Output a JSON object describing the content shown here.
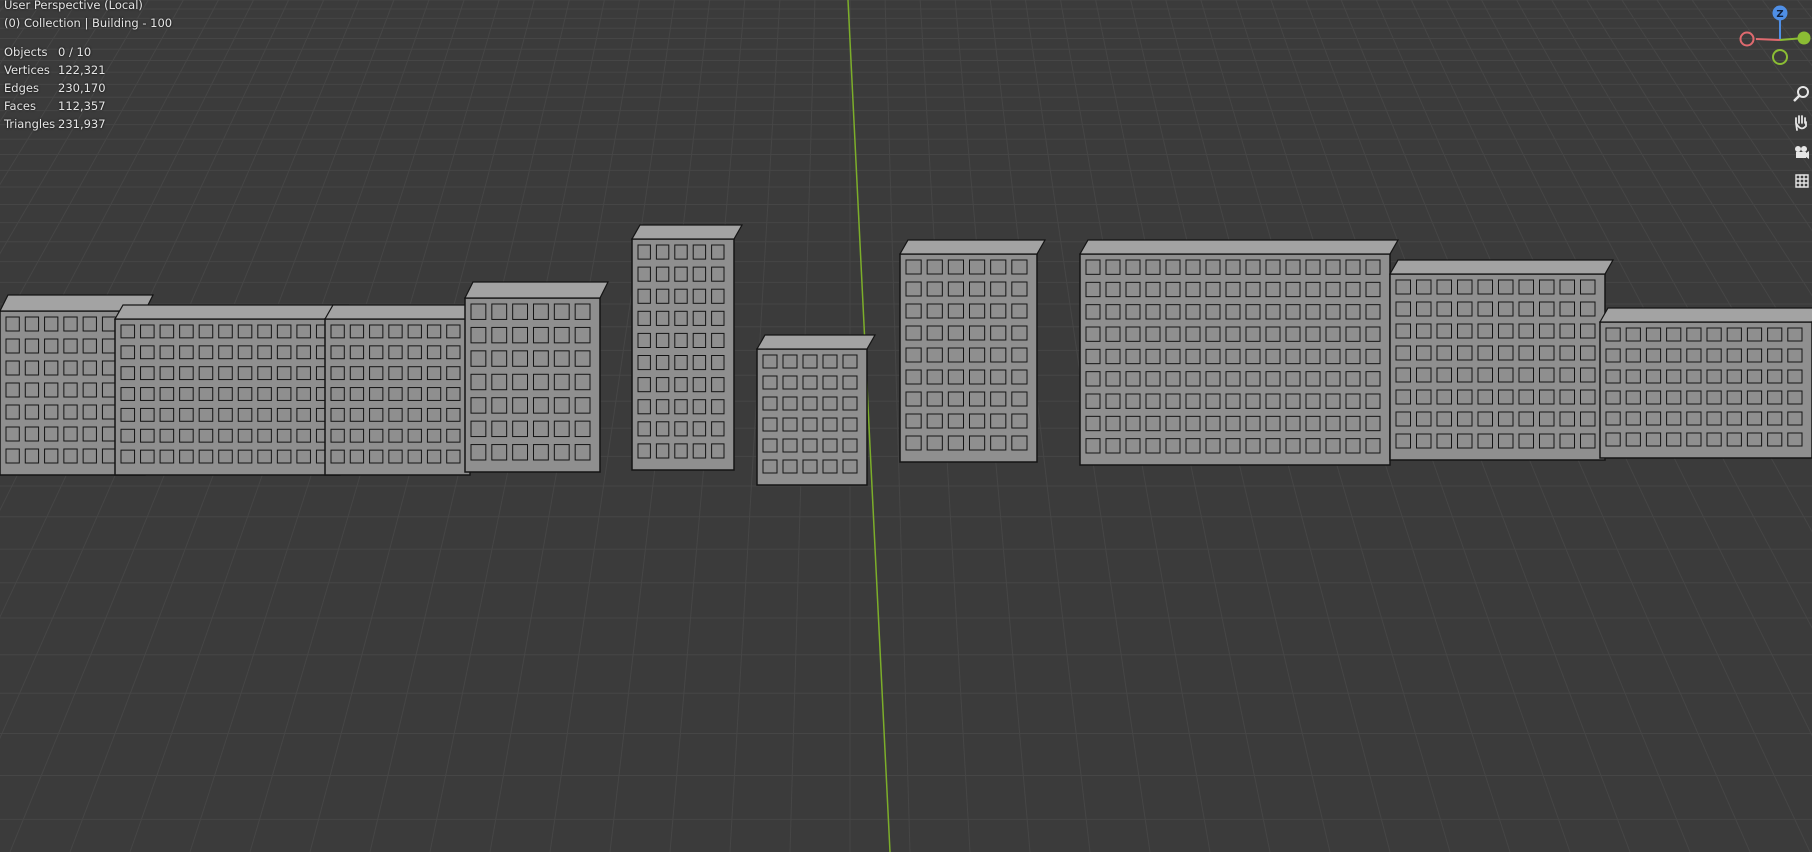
{
  "viewport": {
    "title": "User Perspective (Local)",
    "collection": "(0) Collection | Building - 100"
  },
  "stats": [
    {
      "label": "Objects",
      "value": "0 / 10"
    },
    {
      "label": "Vertices",
      "value": "122,321"
    },
    {
      "label": "Edges",
      "value": "230,170"
    },
    {
      "label": "Faces",
      "value": "112,357"
    },
    {
      "label": "Triangles",
      "value": "231,937"
    }
  ],
  "gizmo": {
    "z_label": "Z",
    "colors": {
      "x": "#e06a6f",
      "y": "#8bbd34",
      "z": "#4f8fe6"
    }
  },
  "nav_icons": [
    "zoom-icon",
    "hand-pan-icon",
    "camera-icon",
    "grid-view-icon"
  ],
  "colors": {
    "background": "#3b3b3b",
    "grid": "#464646",
    "y_axis": "#7cae2a",
    "building_fill": "#8f8f8f",
    "building_edge": "#141414"
  }
}
